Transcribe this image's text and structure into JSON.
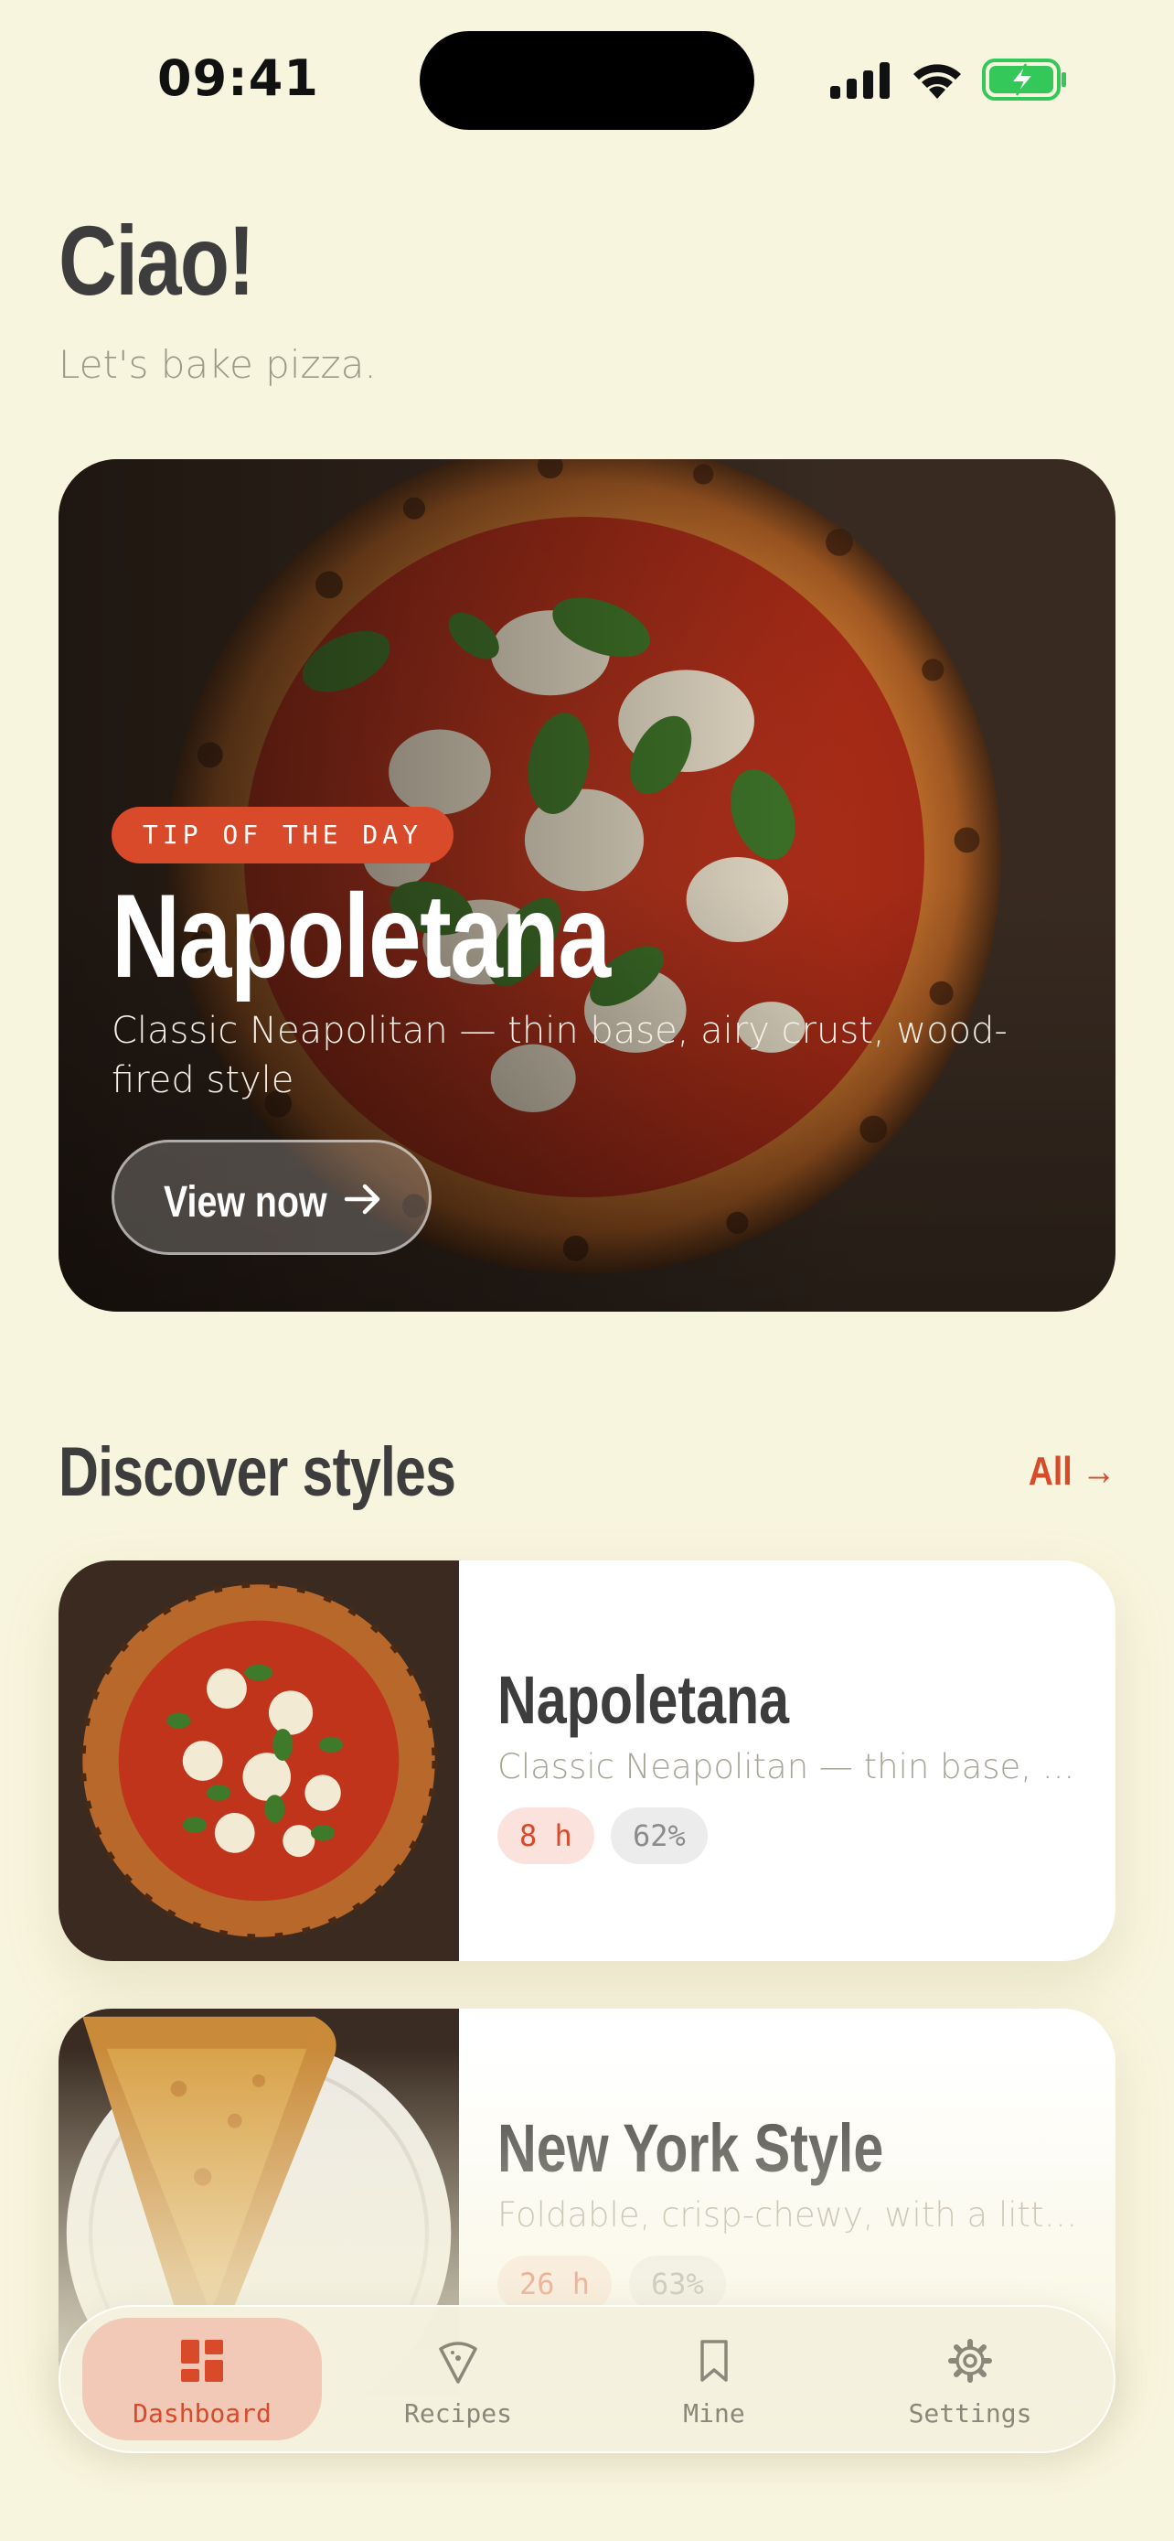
{
  "status_bar": {
    "time": "09:41"
  },
  "header": {
    "greeting": "Ciao!",
    "subtitle": "Let's bake pizza."
  },
  "hero": {
    "badge": "TIP OF THE DAY",
    "title": "Napoletana",
    "description": "Classic Neapolitan — thin base, airy crust, wood-fired style",
    "button_label": "View now"
  },
  "discover": {
    "title": "Discover styles",
    "all_label": "All →",
    "cards": [
      {
        "title": "Napoletana",
        "description": "Classic Neapolitan — thin base, ...",
        "time": "8 h",
        "hydration": "62%"
      },
      {
        "title": "New York Style",
        "description": "Foldable, crisp-chewy, with a littl...",
        "time": "26 h",
        "hydration": "63%"
      }
    ]
  },
  "tabbar": {
    "items": [
      {
        "label": "Dashboard",
        "icon": "dashboard-icon",
        "active": true
      },
      {
        "label": "Recipes",
        "icon": "pizza-slice-icon",
        "active": false
      },
      {
        "label": "Mine",
        "icon": "bookmark-icon",
        "active": false
      },
      {
        "label": "Settings",
        "icon": "gear-icon",
        "active": false
      }
    ]
  },
  "colors": {
    "background": "#f8f5de",
    "accent": "#d94a2b",
    "text": "#3d3d3d",
    "muted": "#9a9887",
    "battery": "#34c759"
  }
}
